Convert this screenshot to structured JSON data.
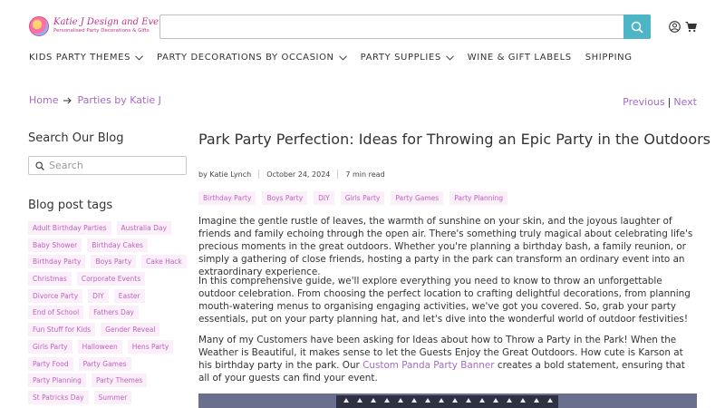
{
  "brand": {
    "title": "Katie J Design and Events",
    "subtitle": "Personalised Party Decorations & Gifts"
  },
  "search": {
    "value": ""
  },
  "nav": [
    {
      "label": "KIDS PARTY THEMES",
      "dropdown": true
    },
    {
      "label": "PARTY DECORATIONS BY OCCASION",
      "dropdown": true
    },
    {
      "label": "PARTY SUPPLIES",
      "dropdown": true
    },
    {
      "label": "WINE & GIFT LABELS",
      "dropdown": false
    },
    {
      "label": "SHIPPING",
      "dropdown": false
    }
  ],
  "breadcrumb": {
    "home": "Home",
    "current": "Parties by Katie J"
  },
  "pager": {
    "previous": "Previous",
    "separator": "|",
    "next": "Next"
  },
  "sidebar": {
    "search_title": "Search Our Blog",
    "search_placeholder": "Search",
    "tags_title": "Blog post tags",
    "tags": [
      [
        "Adult Birthday Parties",
        "Australia Day"
      ],
      [
        "Baby Shower",
        "Birthday Cakes"
      ],
      [
        "Birthday Party",
        "Boys Party",
        "Cake Hack"
      ],
      [
        "Christmas",
        "Corporate Events"
      ],
      [
        "Divorce Party",
        "DIY",
        "Easter"
      ],
      [
        "End of School",
        "Fathers Day"
      ],
      [
        "Fun Stuff for Kids",
        "Gender Reveal"
      ],
      [
        "Girls Party",
        "Halloween",
        "Hens Party"
      ],
      [
        "Party Food",
        "Party Games"
      ],
      [
        "Party Planning",
        "Party Themes"
      ],
      [
        "St Patricks Day",
        "Summer"
      ]
    ]
  },
  "article": {
    "title": "Park Party Perfection: Ideas for Throwing an Epic Party in the Outdoors",
    "author": "by Katie Lynch",
    "date": "October 24, 2024",
    "read_time": "7 min read",
    "tags": [
      "Birthday Party",
      "Boys Party",
      "DIY",
      "Girls Party",
      "Party Games",
      "Party Planning"
    ],
    "p1": "Imagine the gentle rustle of leaves, the warmth of sunshine on your skin, and the joyous laughter of friends and family echoing through the open air. There's something truly magical about celebrating life's precious moments in the great outdoors. Whether you're planning a birthday bash, a family reunion, or simply a gathering of close friends, hosting a party in the park can transform an ordinary event into an extraordinary experience.",
    "p2": "In this comprehensive guide, we'll explore everything you need to know to throw an unforgettable outdoor celebration. From choosing the perfect location to crafting delightful decorations, from planning mouth-watering menus to organising engaging activities, we've got you covered. So, grab your party essentials, put on your party planning hat, and let's dive into the wonderful world of outdoor festivities!",
    "p3_before": "Many of my Customers have been asking for Ideas about how to Throw a Party in the Park! When the Weather is Beautiful, it makes sense to let the Guests Enjoy the Great Outdoors. How cute is Karson at his birthday party in the park. Our ",
    "p3_link": "Custom Panda Party Banner",
    "p3_after": " creates a bold statement, ensuring that all of your guests can find your event."
  },
  "colors": {
    "accent": "#a56cc1",
    "search_button": "#4cb5c6",
    "tag_bg": "#fbf0f9",
    "tag_text": "#c061c0"
  }
}
